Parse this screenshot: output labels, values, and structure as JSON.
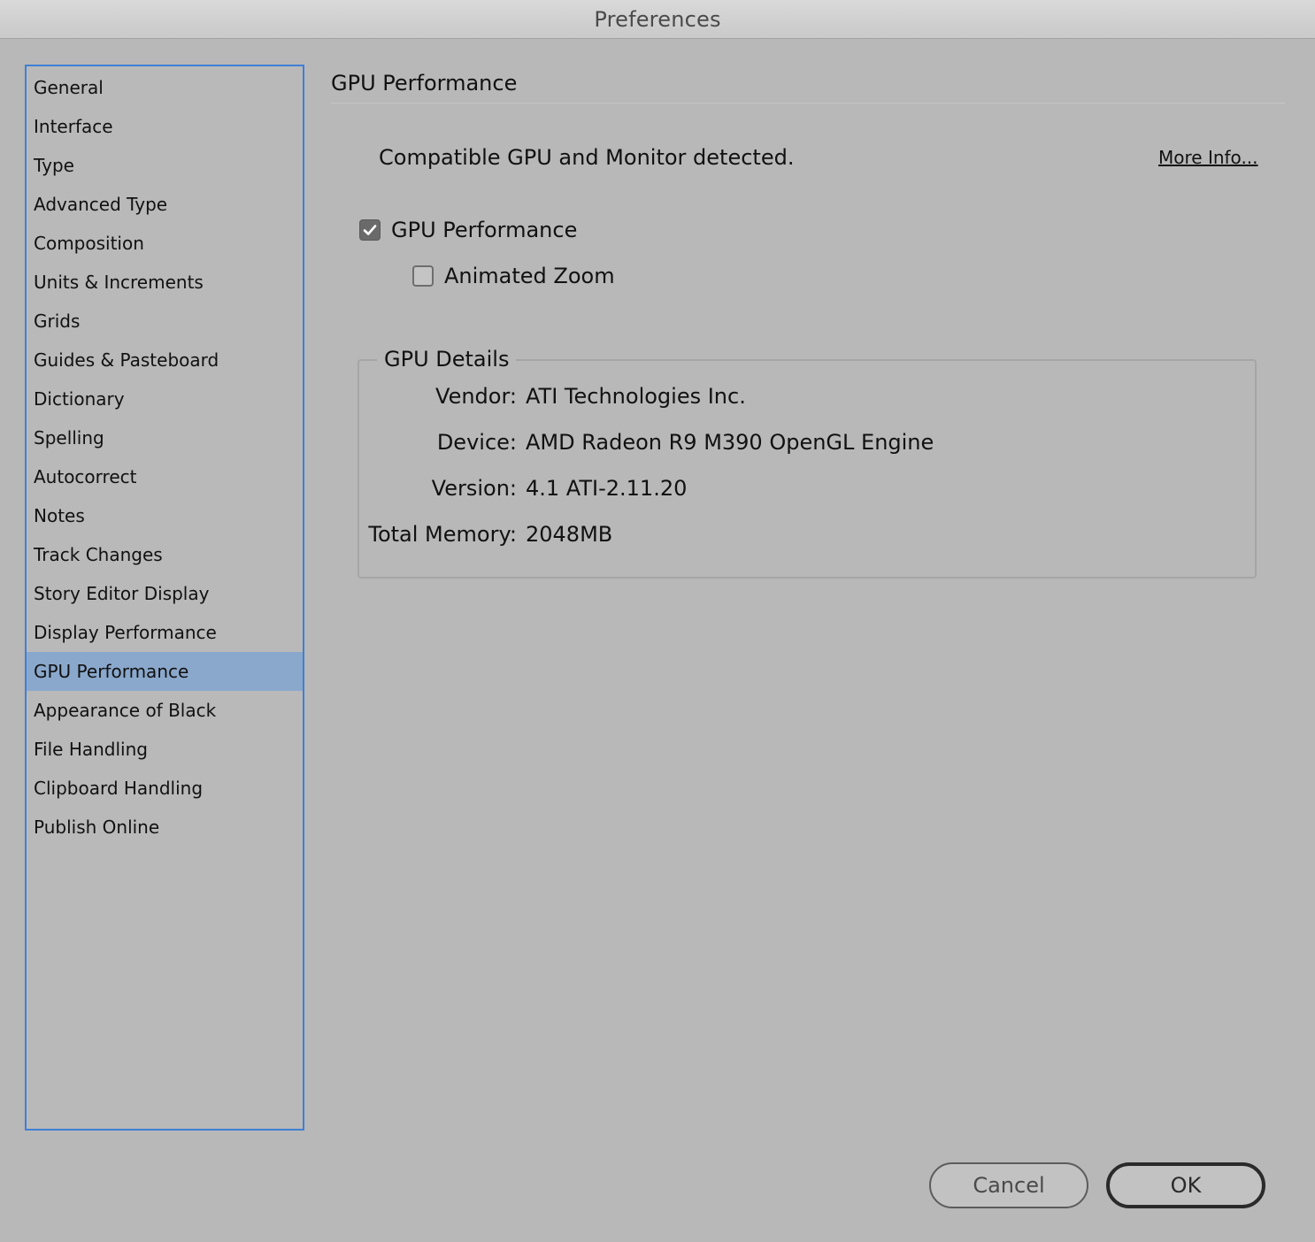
{
  "window": {
    "title": "Preferences"
  },
  "sidebar": {
    "items": [
      {
        "label": "General"
      },
      {
        "label": "Interface"
      },
      {
        "label": "Type"
      },
      {
        "label": "Advanced Type"
      },
      {
        "label": "Composition"
      },
      {
        "label": "Units & Increments"
      },
      {
        "label": "Grids"
      },
      {
        "label": "Guides & Pasteboard"
      },
      {
        "label": "Dictionary"
      },
      {
        "label": "Spelling"
      },
      {
        "label": "Autocorrect"
      },
      {
        "label": "Notes"
      },
      {
        "label": "Track Changes"
      },
      {
        "label": "Story Editor Display"
      },
      {
        "label": "Display Performance"
      },
      {
        "label": "GPU Performance",
        "selected": true
      },
      {
        "label": "Appearance of Black"
      },
      {
        "label": "File Handling"
      },
      {
        "label": "Clipboard Handling"
      },
      {
        "label": "Publish Online"
      }
    ]
  },
  "panel": {
    "title": "GPU Performance",
    "status": "Compatible GPU and Monitor detected.",
    "more_info": "More Info...",
    "gpu_performance": {
      "label": "GPU Performance",
      "checked": true
    },
    "animated_zoom": {
      "label": "Animated Zoom",
      "checked": false
    },
    "details": {
      "legend": "GPU Details",
      "vendor_label": "Vendor:",
      "vendor": "ATI Technologies Inc.",
      "device_label": "Device:",
      "device": "AMD Radeon R9 M390 OpenGL Engine",
      "version_label": "Version:",
      "version": "4.1 ATI-2.11.20",
      "memory_label": "Total Memory:",
      "memory": "2048MB"
    }
  },
  "buttons": {
    "cancel": "Cancel",
    "ok": "OK"
  },
  "colors": {
    "selection": "#8aa8cc",
    "focus_border": "#3f7fd6",
    "background": "#b8b8b8"
  }
}
